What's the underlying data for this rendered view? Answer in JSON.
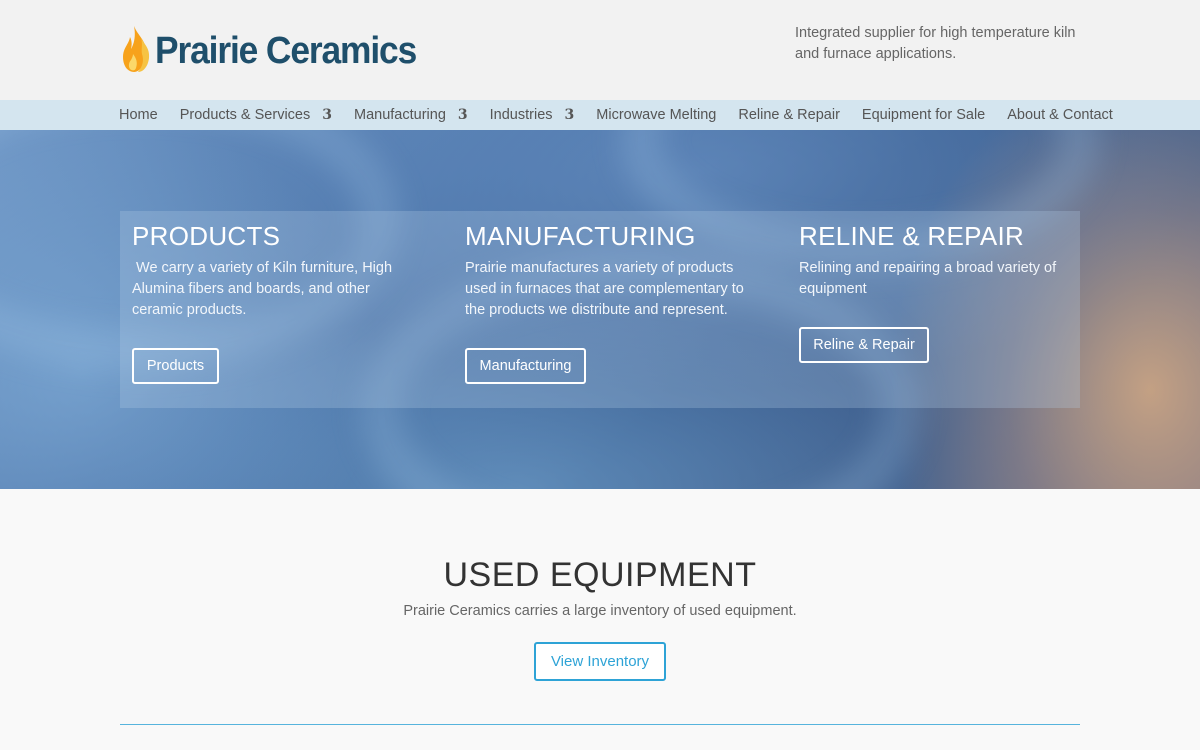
{
  "brand": {
    "name": "Prairie Ceramics",
    "logo_icon": "flame-icon",
    "logo_colors": [
      "#f7a21b",
      "#f6c343"
    ],
    "name_color": "#1f4f6b"
  },
  "header": {
    "tagline": "Integrated supplier for high temperature kiln and furnace applications."
  },
  "nav": {
    "items": [
      {
        "label": "Home",
        "caret": ""
      },
      {
        "label": "Products & Services",
        "caret": "3"
      },
      {
        "label": "Manufacturing",
        "caret": "3"
      },
      {
        "label": "Industries",
        "caret": "3"
      },
      {
        "label": "Microwave Melting",
        "caret": ""
      },
      {
        "label": "Reline & Repair",
        "caret": ""
      },
      {
        "label": "Equipment for Sale",
        "caret": ""
      },
      {
        "label": "About & Contact",
        "caret": ""
      }
    ]
  },
  "hero": {
    "columns": [
      {
        "title": "PRODUCTS",
        "text": " We carry a variety of Kiln furniture, High Alumina fibers and boards, and other ceramic products.",
        "button": "Products"
      },
      {
        "title": "MANUFACTURING",
        "text": "Prairie manufactures a variety of products used in furnaces that are complementary to the products we distribute and represent.",
        "button": "Manufacturing"
      },
      {
        "title": "RELINE & REPAIR",
        "text": "Relining and repairing a broad variety of equipment",
        "button": "Reline & Repair"
      }
    ]
  },
  "used_equipment": {
    "title": "USED EQUIPMENT",
    "subtitle": "Prairie Ceramics carries a large inventory of used equipment.",
    "button": "View Inventory",
    "accent": "#2ea3d6"
  }
}
